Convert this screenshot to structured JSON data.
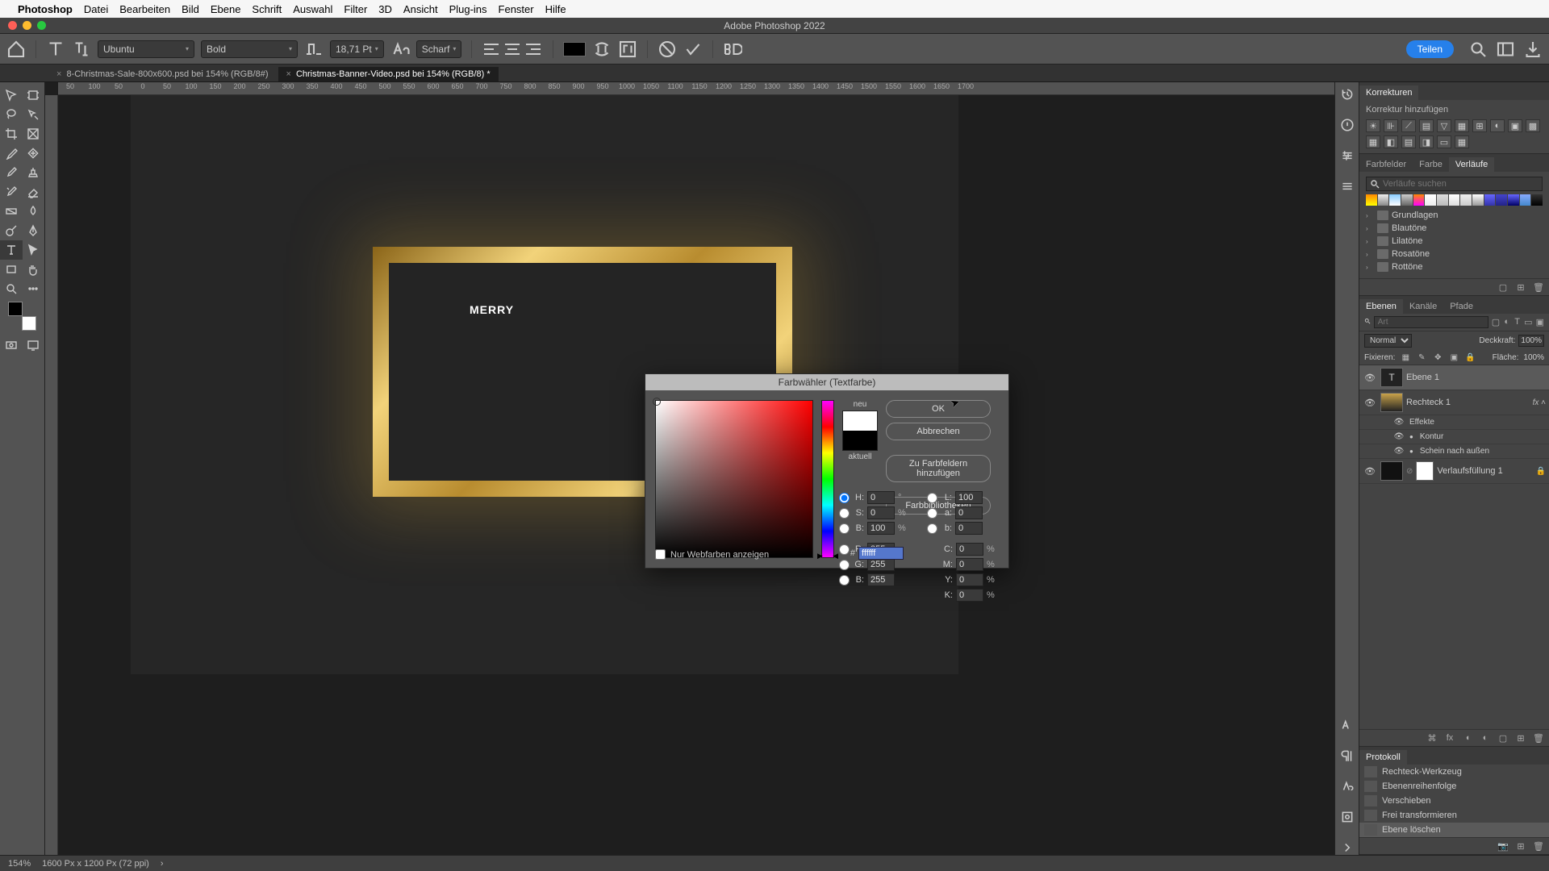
{
  "menubar": {
    "app": "Photoshop",
    "items": [
      "Datei",
      "Bearbeiten",
      "Bild",
      "Ebene",
      "Schrift",
      "Auswahl",
      "Filter",
      "3D",
      "Ansicht",
      "Plug-ins",
      "Fenster",
      "Hilfe"
    ]
  },
  "window_title": "Adobe Photoshop 2022",
  "options": {
    "font": "Ubuntu",
    "weight": "Bold",
    "size": "18,71 Pt",
    "aa": "Scharf",
    "share": "Teilen"
  },
  "tabs": [
    {
      "label": "8-Christmas-Sale-800x600.psd bei 154% (RGB/8#)",
      "active": false
    },
    {
      "label": "Christmas-Banner-Video.psd bei 154% (RGB/8) *",
      "active": true
    }
  ],
  "ruler_ticks": [
    "50",
    "100",
    "50",
    "0",
    "50",
    "100",
    "150",
    "200",
    "250",
    "300",
    "350",
    "400",
    "450",
    "500",
    "550",
    "600",
    "650",
    "700",
    "750",
    "800",
    "850",
    "900",
    "950",
    "1000",
    "1050",
    "1100",
    "1150",
    "1200",
    "1250",
    "1300",
    "1350",
    "1400",
    "1450",
    "1500",
    "1550",
    "1600",
    "1650",
    "1700"
  ],
  "canvas_text": "MERRY",
  "color_picker": {
    "title": "Farbwähler (Textfarbe)",
    "new_label": "neu",
    "current_label": "aktuell",
    "buttons": {
      "ok": "OK",
      "cancel": "Abbrechen",
      "add": "Zu Farbfeldern hinzufügen",
      "lib": "Farbbibliotheken"
    },
    "hsb": {
      "H": "0",
      "S": "0",
      "B": "100"
    },
    "rgb": {
      "R": "255",
      "G": "255",
      "B": "255"
    },
    "lab": {
      "L": "100",
      "a": "0",
      "b": "0"
    },
    "cmyk": {
      "C": "0",
      "M": "0",
      "Y": "0",
      "K": "0"
    },
    "hex": "ffffff",
    "webonly": "Nur Webfarben anzeigen"
  },
  "adjustments": {
    "tab": "Korrekturen",
    "label": "Korrektur hinzufügen"
  },
  "gradients": {
    "tabs": [
      "Farbfelder",
      "Farbe",
      "Verläufe"
    ],
    "search_placeholder": "Verläufe suchen",
    "folders": [
      "Grundlagen",
      "Blautöne",
      "Lilatöne",
      "Rosatöne",
      "Rottöne"
    ]
  },
  "layers": {
    "tabs": [
      "Ebenen",
      "Kanäle",
      "Pfade"
    ],
    "blend": "Normal",
    "opacity_label": "Deckkraft:",
    "opacity": "100%",
    "lock_label": "Fixieren:",
    "fill_label": "Fläche:",
    "fill": "100%",
    "search_placeholder": "Art",
    "items": [
      {
        "name": "Ebene 1",
        "type": "text",
        "selected": true
      },
      {
        "name": "Rechteck 1",
        "type": "shape",
        "fx": true
      },
      {
        "name": "Effekte",
        "sub": true
      },
      {
        "name": "Kontur",
        "sub": true,
        "dot": true
      },
      {
        "name": "Schein nach außen",
        "sub": true,
        "dot": true
      },
      {
        "name": "Verlaufsfüllung 1",
        "type": "fill",
        "locked": true
      }
    ]
  },
  "history": {
    "tab": "Protokoll",
    "items": [
      "Rechteck-Werkzeug",
      "Ebenenreihenfolge",
      "Verschieben",
      "Frei transformieren",
      "Ebene löschen"
    ]
  },
  "status": {
    "zoom": "154%",
    "dims": "1600 Px x 1200 Px (72 ppi)"
  }
}
